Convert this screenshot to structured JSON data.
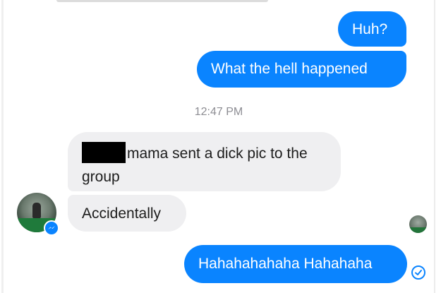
{
  "conversation": {
    "messages": [
      {
        "text": "Huh?",
        "direction": "outgoing"
      },
      {
        "text": "What the hell happened",
        "direction": "outgoing"
      },
      {
        "text": "mama sent a dick pic to the group",
        "direction": "incoming",
        "redacted_prefix": true
      },
      {
        "text": "Accidentally",
        "direction": "incoming"
      },
      {
        "text": "Hahahahahaha Hahahaha",
        "direction": "outgoing"
      }
    ],
    "timestamp": "12:47 PM"
  },
  "colors": {
    "outgoing_bubble": "#0a84ff",
    "incoming_bubble": "#efeff1",
    "timestamp": "#8d8d93"
  },
  "icons": {
    "sender_badge": "messenger-icon",
    "read_receipt": "seen-avatar-icon",
    "delivered": "check-circle-icon"
  }
}
